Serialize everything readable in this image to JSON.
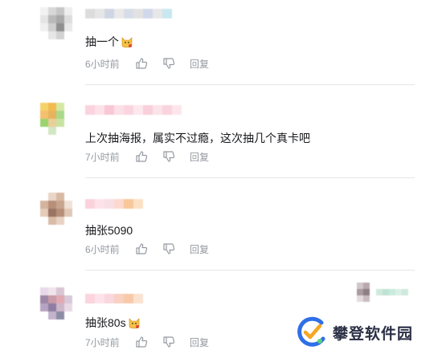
{
  "comments": [
    {
      "text": "抽一个",
      "has_emoji": true,
      "time": "6小时前",
      "reply_label": "回复",
      "avatar_colors": [
        "#f2f2f2",
        "#d8d8d8",
        "#c6c6c6",
        "#eeeeee",
        "#e4e4e4",
        "#b9b9b9",
        "#a8a8a8",
        "#dcdcdc",
        "#f0f0f0",
        "#cfcfcf",
        "#8f8f8f",
        "#e8e8e8",
        "#ffffff",
        "#e6e6e6",
        "#d2d2d2",
        "#ffffff"
      ],
      "name_colors": [
        "#dcdcdc",
        "#e6e6e6",
        "#cfd6e3",
        "#e9e9e9",
        "#d7dde8",
        "#e2e2e2",
        "#d0d8ea",
        "#e7e7e7",
        "#c9e7f0"
      ]
    },
    {
      "text": "上次抽海报，属实不过瘾，这次抽几个真卡吧",
      "has_emoji": false,
      "time": "7小时前",
      "reply_label": "回复",
      "avatar_colors": [
        "#f6d26a",
        "#f1bb52",
        "#d6e9a4",
        "#ffffff",
        "#f4c06e",
        "#e7b35e",
        "#a9d98a",
        "#ffffff",
        "#9bd36e",
        "#e9cf9a",
        "#c8e3a1",
        "#ffffff",
        "#ffffff",
        "#d2e7c4",
        "#ffffff",
        "#ffffff"
      ],
      "name_colors": [
        "#fbd3df",
        "#fde1e9",
        "#f9c7d6",
        "#fce0e8",
        "#fad5df",
        "#fde8ee",
        "#f8cfdb",
        "#fbe3ea",
        "#f9d4de",
        "#fde5ec"
      ]
    },
    {
      "text": "抽张5090",
      "has_emoji": false,
      "time": "6小时前",
      "reply_label": "回复",
      "avatar_colors": [
        "#ffffff",
        "#e9d6c8",
        "#d9b9a3",
        "#ffffff",
        "#d4b49e",
        "#b8907a",
        "#c7a48d",
        "#efe1d6",
        "#e6cbb8",
        "#9a7462",
        "#b68f78",
        "#e0c8b6",
        "#ffffff",
        "#d9bba8",
        "#e7d2c3",
        "#ffffff"
      ],
      "name_colors": [
        "#fbd2dc",
        "#fde3e9",
        "#f8dfe6",
        "#fcd8cf",
        "#f8c89a",
        "#fbe0c4"
      ]
    },
    {
      "text": "抽张80s",
      "has_emoji": true,
      "time": "7小时前",
      "reply_label": "回复",
      "avatar_colors": [
        "#e7d9ea",
        "#f0e4ea",
        "#d9c6d4",
        "#ffffff",
        "#9d86a6",
        "#c99aa8",
        "#e0a9b4",
        "#d7c9d8",
        "#b7a3c2",
        "#8f7ea2",
        "#cdb6c8",
        "#e8d9e4",
        "#ffffff",
        "#c3b3cc",
        "#8d8ca5",
        "#ffffff"
      ],
      "name_colors": [
        "#fbd4dd",
        "#fde3e9",
        "#fad6de",
        "#f8d1c2",
        "#f7c9a8",
        "#fbe1cf"
      ]
    }
  ],
  "mosaic_right_colors": [
    "#cfc7c9",
    "#b9a9ad",
    "#ffffff",
    "#ffffff",
    "#ffffff",
    "#ffffff",
    "#ffffff",
    "#ffffff",
    "#ffffff",
    "#a99aa0",
    "#8d7d84",
    "#ffffff",
    "#cfe9dc",
    "#bfe3d3",
    "#c8ebdc",
    "#d9f0e6",
    "#cfe9de",
    "#ffffff",
    "#e3dadd",
    "#c9bcc1",
    "#ffffff",
    "#ffffff",
    "#ffffff",
    "#ffffff",
    "#ffffff",
    "#ffffff",
    "#ffffff"
  ],
  "watermark": {
    "text": "攀登软件园",
    "logo_colors": [
      "#2f6fe8",
      "#f5a623",
      "#5fcf7a"
    ]
  }
}
